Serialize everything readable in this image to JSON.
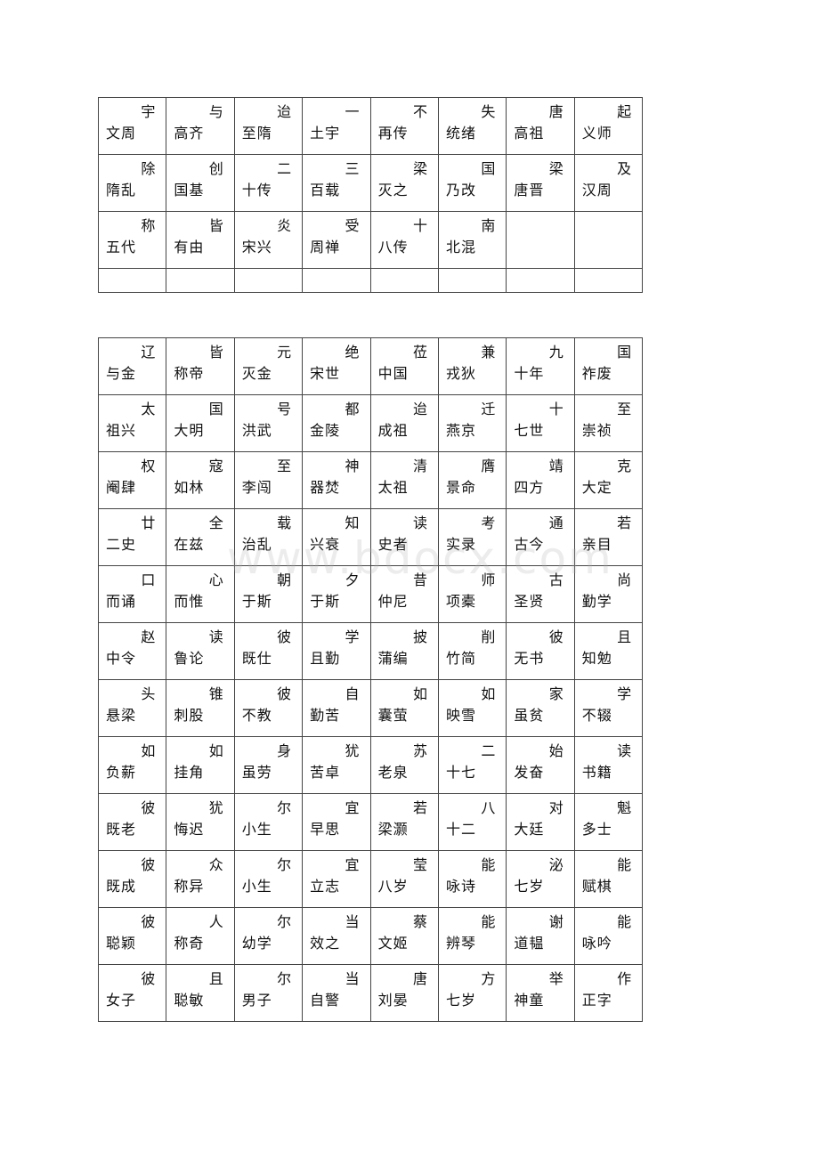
{
  "table1": {
    "rows": [
      [
        [
          "宇",
          "文周"
        ],
        [
          "与",
          "高齐"
        ],
        [
          "迨",
          "至隋"
        ],
        [
          "一",
          "土宇"
        ],
        [
          "不",
          "再传"
        ],
        [
          "失",
          "统绪"
        ],
        [
          "唐",
          "高祖"
        ],
        [
          "起",
          "义师"
        ]
      ],
      [
        [
          "除",
          "隋乱"
        ],
        [
          "创",
          "国基"
        ],
        [
          "二",
          "十传"
        ],
        [
          "三",
          "百载"
        ],
        [
          "梁",
          "灭之"
        ],
        [
          "国",
          "乃改"
        ],
        [
          "梁",
          "唐晋"
        ],
        [
          "及",
          "汉周"
        ]
      ],
      [
        [
          "称",
          "五代"
        ],
        [
          "皆",
          "有由"
        ],
        [
          "炎",
          "宋兴"
        ],
        [
          "受",
          "周禅"
        ],
        [
          "十",
          "八传"
        ],
        [
          "南",
          "北混"
        ],
        [
          "",
          ""
        ],
        [
          "",
          ""
        ]
      ]
    ]
  },
  "table2": {
    "rows": [
      [
        [
          "辽",
          "与金"
        ],
        [
          "皆",
          "称帝"
        ],
        [
          "元",
          "灭金"
        ],
        [
          "绝",
          "宋世"
        ],
        [
          "莅",
          "中国"
        ],
        [
          "兼",
          "戎狄"
        ],
        [
          "九",
          "十年"
        ],
        [
          "国",
          "祚废"
        ]
      ],
      [
        [
          "太",
          "祖兴"
        ],
        [
          "国",
          "大明"
        ],
        [
          "号",
          "洪武"
        ],
        [
          "都",
          "金陵"
        ],
        [
          "迨",
          "成祖"
        ],
        [
          "迁",
          "燕京"
        ],
        [
          "十",
          "七世"
        ],
        [
          "至",
          "崇祯"
        ]
      ],
      [
        [
          "权",
          "阉肆"
        ],
        [
          "寇",
          "如林"
        ],
        [
          "至",
          "李闯"
        ],
        [
          "神",
          "器焚"
        ],
        [
          "清",
          "太祖"
        ],
        [
          "膺",
          "景命"
        ],
        [
          "靖",
          "四方"
        ],
        [
          "克",
          "大定"
        ]
      ],
      [
        [
          "廿",
          "二史"
        ],
        [
          "全",
          "在兹"
        ],
        [
          "载",
          "治乱"
        ],
        [
          "知",
          "兴衰"
        ],
        [
          "读",
          "史者"
        ],
        [
          "考",
          "实录"
        ],
        [
          "通",
          "古今"
        ],
        [
          "若",
          "亲目"
        ]
      ],
      [
        [
          "口",
          "而诵"
        ],
        [
          "心",
          "而惟"
        ],
        [
          "朝",
          "于斯"
        ],
        [
          "夕",
          "于斯"
        ],
        [
          "昔",
          "仲尼"
        ],
        [
          "师",
          "项橐"
        ],
        [
          "古",
          "圣贤"
        ],
        [
          "尚",
          "勤学"
        ]
      ],
      [
        [
          "赵",
          "中令"
        ],
        [
          "读",
          "鲁论"
        ],
        [
          "彼",
          "既仕"
        ],
        [
          "学",
          "且勤"
        ],
        [
          "披",
          "蒲编"
        ],
        [
          "削",
          "竹简"
        ],
        [
          "彼",
          "无书"
        ],
        [
          "且",
          "知勉"
        ]
      ],
      [
        [
          "头",
          "悬梁"
        ],
        [
          "锥",
          "刺股"
        ],
        [
          "彼",
          "不教"
        ],
        [
          "自",
          "勤苦"
        ],
        [
          "如",
          "囊萤"
        ],
        [
          "如",
          "映雪"
        ],
        [
          "家",
          "虽贫"
        ],
        [
          "学",
          "不辍"
        ]
      ],
      [
        [
          "如",
          "负薪"
        ],
        [
          "如",
          "挂角"
        ],
        [
          "身",
          "虽劳"
        ],
        [
          "犹",
          "苦卓"
        ],
        [
          "苏",
          "老泉"
        ],
        [
          "二",
          "十七"
        ],
        [
          "始",
          "发奋"
        ],
        [
          "读",
          "书籍"
        ]
      ],
      [
        [
          "彼",
          "既老"
        ],
        [
          "犹",
          "悔迟"
        ],
        [
          "尔",
          "小生"
        ],
        [
          "宜",
          "早思"
        ],
        [
          "若",
          "梁灏"
        ],
        [
          "八",
          "十二"
        ],
        [
          "对",
          "大廷"
        ],
        [
          "魁",
          "多士"
        ]
      ],
      [
        [
          "彼",
          "既成"
        ],
        [
          "众",
          "称异"
        ],
        [
          "尔",
          "小生"
        ],
        [
          "宜",
          "立志"
        ],
        [
          "莹",
          "八岁"
        ],
        [
          "能",
          "咏诗"
        ],
        [
          "泌",
          "七岁"
        ],
        [
          "能",
          "赋棋"
        ]
      ],
      [
        [
          "彼",
          "聪颖"
        ],
        [
          "人",
          "称奇"
        ],
        [
          "尔",
          "幼学"
        ],
        [
          "当",
          "效之"
        ],
        [
          "蔡",
          "文姬"
        ],
        [
          "能",
          "辨琴"
        ],
        [
          "谢",
          "道韫"
        ],
        [
          "能",
          "咏吟"
        ]
      ],
      [
        [
          "彼",
          "女子"
        ],
        [
          "且",
          "聪敏"
        ],
        [
          "尔",
          "男子"
        ],
        [
          "当",
          "自警"
        ],
        [
          "唐",
          "刘晏"
        ],
        [
          "方",
          "七岁"
        ],
        [
          "举",
          "神童"
        ],
        [
          "作",
          "正字"
        ]
      ]
    ]
  },
  "watermark": "www.bdocx.com"
}
